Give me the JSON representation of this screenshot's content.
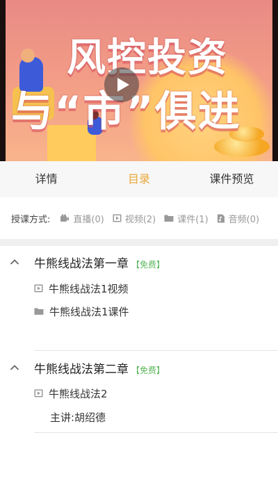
{
  "banner": {
    "line1": "风控投资",
    "line2": "与“市”俱进"
  },
  "tabs": [
    {
      "label": "详情"
    },
    {
      "label": "目录",
      "active": true
    },
    {
      "label": "课件预览"
    }
  ],
  "modes": {
    "label": "授课方式:",
    "items": [
      {
        "icon": "live-camera-icon",
        "label": "直播(0)"
      },
      {
        "icon": "video-icon",
        "label": "视频(2)"
      },
      {
        "icon": "folder-icon",
        "label": "课件(1)"
      },
      {
        "icon": "audio-icon",
        "label": "音频(0)"
      }
    ]
  },
  "chapters": [
    {
      "title": "牛熊线战法第一章",
      "tag": "【免费】",
      "lessons": [
        {
          "icon": "video-icon",
          "title": "牛熊线战法1视频"
        },
        {
          "icon": "folder-icon",
          "title": "牛熊线战法1课件"
        }
      ]
    },
    {
      "title": "牛熊线战法第二章",
      "tag": "【免费】",
      "lessons": [
        {
          "icon": "video-icon",
          "title": "牛熊线战法2"
        }
      ],
      "teacher": "主讲:胡绍德"
    }
  ],
  "colors": {
    "accent": "#e9a83a",
    "free": "#5cb85c",
    "muted": "#999999"
  }
}
